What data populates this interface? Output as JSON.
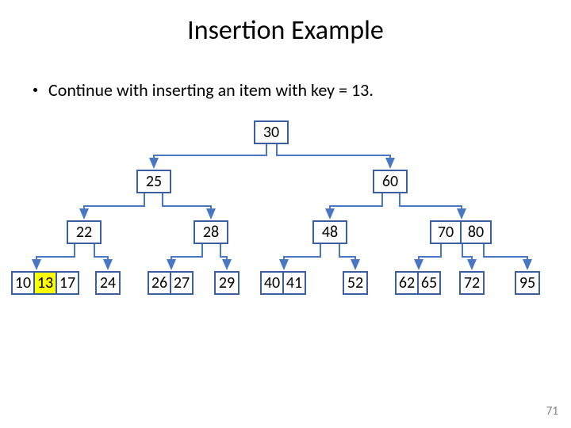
{
  "title": "Insertion Example",
  "bullet": "Continue with inserting an item with key = 13.",
  "page_number": "71",
  "tree": {
    "root": "30",
    "level2_left": "25",
    "level2_right": "60",
    "level3_a": "22",
    "level3_b": "28",
    "level3_c": "48",
    "level3_d1": "70",
    "level3_d2": "80",
    "leaf_a1": "10",
    "leaf_a2": "13",
    "leaf_a3": "17",
    "leaf_b": "24",
    "leaf_c1": "26",
    "leaf_c2": "27",
    "leaf_d": "29",
    "leaf_e1": "40",
    "leaf_e2": "41",
    "leaf_f": "52",
    "leaf_g1": "62",
    "leaf_g2": "65",
    "leaf_h": "72",
    "leaf_i": "95"
  }
}
